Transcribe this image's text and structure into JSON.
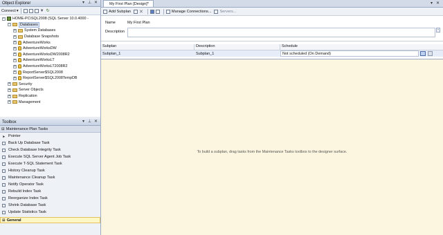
{
  "object_explorer": {
    "title": "Object Explorer",
    "connect_label": "Connect",
    "tree": [
      {
        "label": "HOME-PC\\SQL2008 (SQL Server 10.0.4000 -",
        "kind": "server",
        "indent": 0,
        "expander": "−"
      },
      {
        "label": "Databases",
        "kind": "folder",
        "indent": 1,
        "expander": "−",
        "selected": true
      },
      {
        "label": "System Databases",
        "kind": "folder",
        "indent": 2,
        "expander": "+"
      },
      {
        "label": "Database Snapshots",
        "kind": "folder",
        "indent": 2,
        "expander": "+"
      },
      {
        "label": "AdventureWorks",
        "kind": "db",
        "indent": 2,
        "expander": "+"
      },
      {
        "label": "AdventureWorksDW",
        "kind": "db",
        "indent": 2,
        "expander": "+"
      },
      {
        "label": "AdventureWorksDW2008R2",
        "kind": "db",
        "indent": 2,
        "expander": "+"
      },
      {
        "label": "AdventureWorksLT",
        "kind": "db",
        "indent": 2,
        "expander": "+"
      },
      {
        "label": "AdventureWorksLT2008R2",
        "kind": "db",
        "indent": 2,
        "expander": "+"
      },
      {
        "label": "ReportServer$SQL2008",
        "kind": "db",
        "indent": 2,
        "expander": "+"
      },
      {
        "label": "ReportServer$SQL2008TempDB",
        "kind": "db",
        "indent": 2,
        "expander": "+"
      },
      {
        "label": "Security",
        "kind": "folder",
        "indent": 1,
        "expander": "+"
      },
      {
        "label": "Server Objects",
        "kind": "folder",
        "indent": 1,
        "expander": "+"
      },
      {
        "label": "Replication",
        "kind": "folder",
        "indent": 1,
        "expander": "+"
      },
      {
        "label": "Management",
        "kind": "folder",
        "indent": 1,
        "expander": "+"
      }
    ]
  },
  "toolbox": {
    "title": "Toolbox",
    "section_title": "Maintenance Plan Tasks",
    "items": [
      "Pointer",
      "Back Up Database Task",
      "Check Database Integrity Task",
      "Execute SQL Server Agent Job Task",
      "Execute T-SQL Statement Task",
      "History Cleanup Task",
      "Maintenance Cleanup Task",
      "Notify Operator Task",
      "Rebuild Index Task",
      "Reorganize Index Task",
      "Shrink Database Task",
      "Update Statistics Task"
    ],
    "general_label": "General"
  },
  "designer": {
    "tab_label": "My First Plan [Design]*",
    "toolbar": {
      "add_subplan": "Add Subplan",
      "manage_connections": "Manage Connections...",
      "servers": "Servers..."
    },
    "name_label": "Name",
    "name_value": "My First Plan",
    "description_label": "Description",
    "grid": {
      "headers": [
        "Subplan",
        "Description",
        "Schedule"
      ],
      "rows": [
        [
          "Subplan_1",
          "Subplan_1",
          "Not scheduled (On Demand)"
        ]
      ]
    },
    "surface_hint": "To build a subplan, drag tasks from the Maintenance Tasks toolbox to the designer surface."
  }
}
